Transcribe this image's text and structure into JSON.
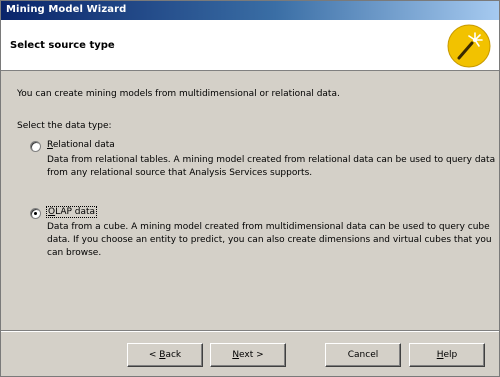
{
  "window": {
    "title": "Mining Model Wizard"
  },
  "header": {
    "title": "Select source type",
    "icon": "magic-wand-icon"
  },
  "body": {
    "intro": "You can create mining models from multidimensional or relational data.",
    "prompt": "Select the data type:",
    "options": [
      {
        "label_prefix": "",
        "label_mnemonic": "R",
        "label_rest": "elational data",
        "description": "Data from relational tables. A mining model created from relational data can be used to query data from any relational source that Analysis Services supports.",
        "selected": false
      },
      {
        "label_prefix": "",
        "label_mnemonic": "O",
        "label_rest": "LAP data",
        "description": "Data from a cube. A mining model created from multidimensional data can be used to query cube data. If you choose an entity to predict, you can also create dimensions and virtual cubes that you can browse.",
        "selected": true
      }
    ]
  },
  "buttons": {
    "back_prefix": "< ",
    "back_mnemonic": "B",
    "back_rest": "ack",
    "next_mnemonic": "N",
    "next_rest": "ext >",
    "cancel": "Cancel",
    "help_mnemonic": "H",
    "help_rest": "elp"
  },
  "colors": {
    "title_gradient_start": "#0a246a",
    "title_gradient_end": "#a6caf0",
    "dialog_face": "#d4d0c8",
    "wand_circle": "#f2c200"
  }
}
